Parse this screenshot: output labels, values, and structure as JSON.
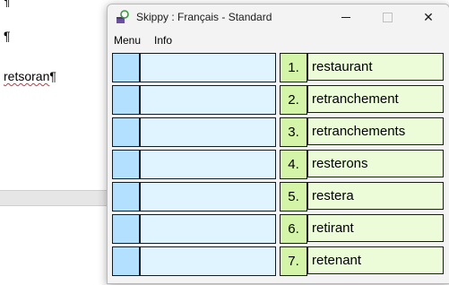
{
  "document": {
    "top_mark": "¶",
    "para_mark": "¶",
    "word": "retsoran",
    "word_mark": "¶"
  },
  "window": {
    "title": "Skippy : Français - Standard",
    "menu": [
      "Menu",
      "Info"
    ],
    "close_glyph": "✕"
  },
  "suggestions": [
    {
      "num": "1.",
      "word": "restaurant"
    },
    {
      "num": "2.",
      "word": "retranchement"
    },
    {
      "num": "3.",
      "word": "retranchements"
    },
    {
      "num": "4.",
      "word": "resterons"
    },
    {
      "num": "5.",
      "word": "restera"
    },
    {
      "num": "6.",
      "word": "retirant"
    },
    {
      "num": "7.",
      "word": "retenant"
    }
  ],
  "colors": {
    "input_index": "#b3e0ff",
    "input_field": "#e0f4ff",
    "suggestion_number": "#d4f5a8",
    "suggestion_word": "#ecfcd8"
  }
}
